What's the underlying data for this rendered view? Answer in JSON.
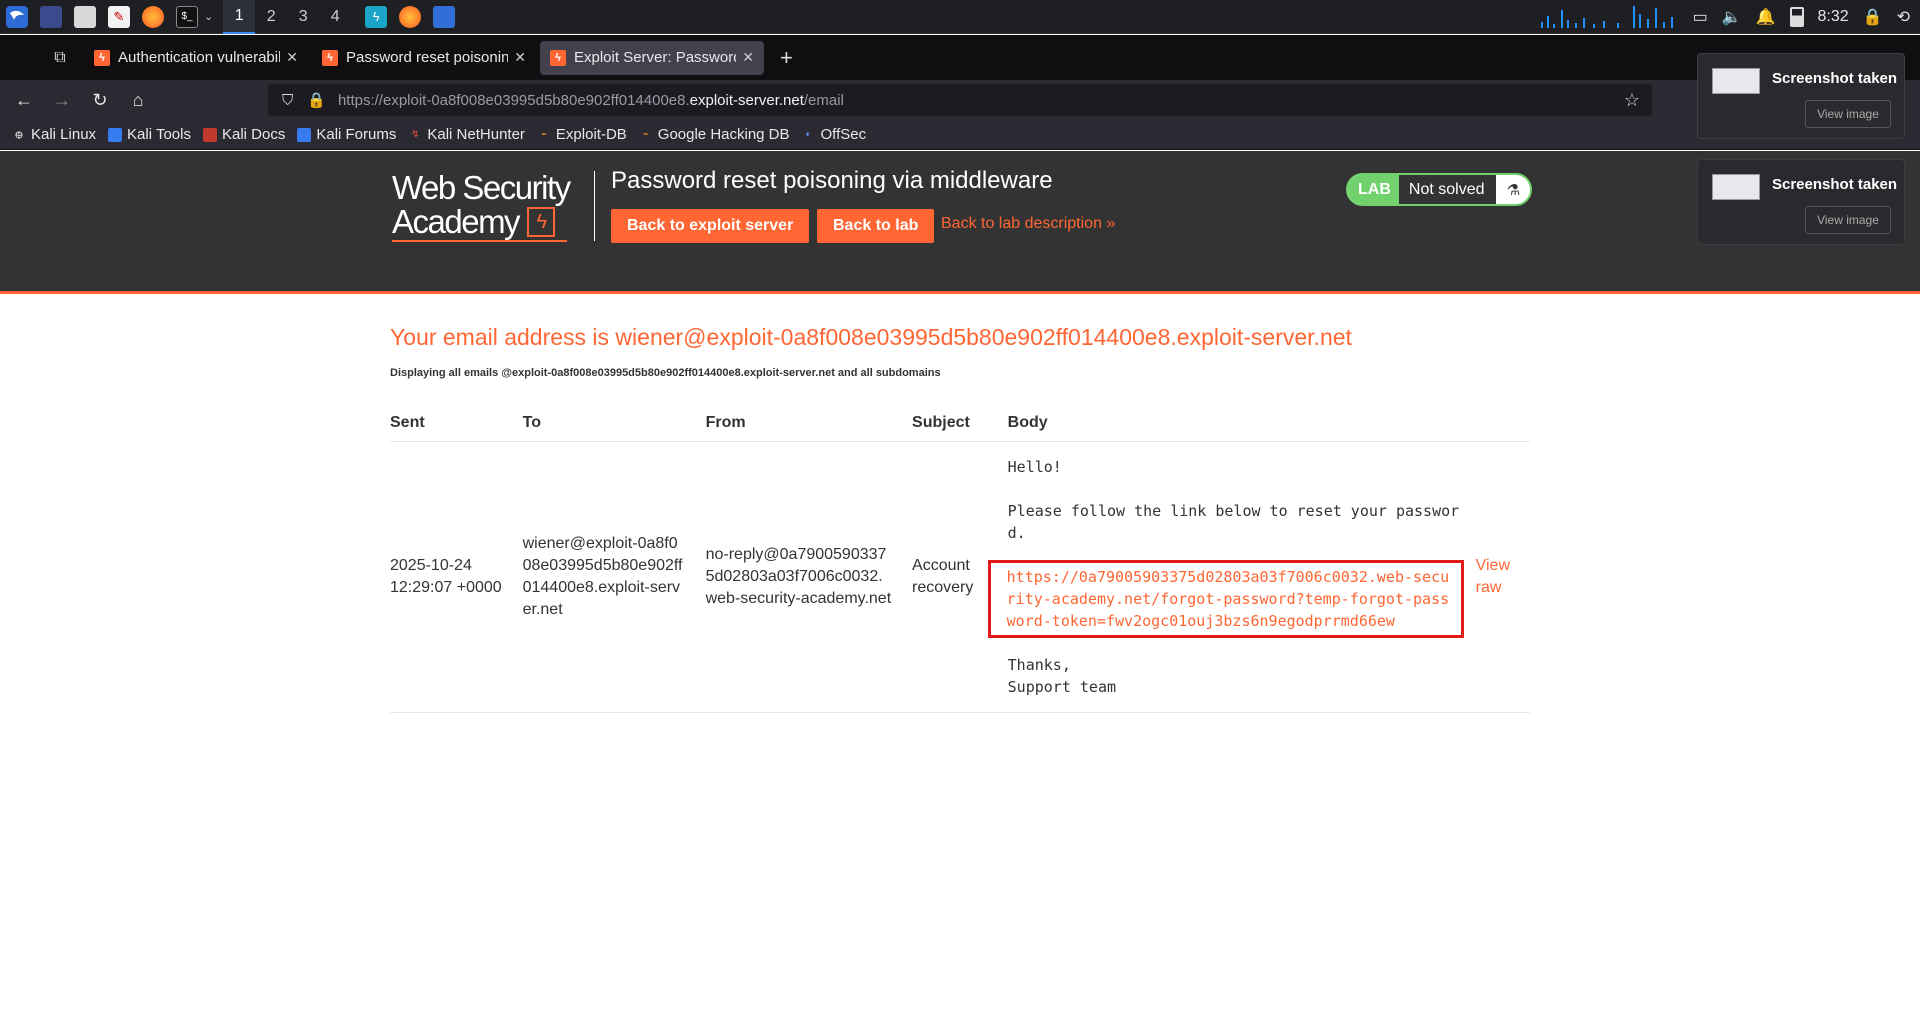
{
  "os": {
    "workspaces": [
      "1",
      "2",
      "3",
      "4"
    ],
    "clock": "8:32"
  },
  "browser": {
    "tabs": [
      {
        "title": "Authentication vulnerabilities"
      },
      {
        "title": "Password reset poisoning via middleware"
      },
      {
        "title": "Exploit Server: Password reset poisoning via middleware"
      }
    ],
    "url": {
      "prefix": "https://exploit-0a8f008e03995d5b80e902ff014400e8.",
      "host": "exploit-server.net",
      "path": "/email"
    },
    "bookmarks": [
      {
        "label": "Kali Linux",
        "icon": "kali-dragon-icon"
      },
      {
        "label": "Kali Tools",
        "icon": "kali-tools-icon"
      },
      {
        "label": "Kali Docs",
        "icon": "kali-docs-icon"
      },
      {
        "label": "Kali Forums",
        "icon": "kali-forums-icon"
      },
      {
        "label": "Kali NetHunter",
        "icon": "nethunter-icon"
      },
      {
        "label": "Exploit-DB",
        "icon": "exploit-db-icon"
      },
      {
        "label": "Google Hacking DB",
        "icon": "ghdb-icon"
      },
      {
        "label": "OffSec",
        "icon": "offsec-icon"
      }
    ]
  },
  "header": {
    "logo_line1": "Web Security",
    "logo_line2": "Academy",
    "lab_title": "Password reset poisoning via middleware",
    "back_to_exploit_server": "Back to exploit server",
    "back_to_lab": "Back to lab",
    "back_to_description": "Back to lab description",
    "status_tag": "LAB",
    "status_text": "Not solved"
  },
  "notifications": [
    {
      "title": "Screenshot taken",
      "button": "View image"
    },
    {
      "title": "Screenshot taken",
      "button": "View image"
    }
  ],
  "main": {
    "heading": "Your email address is wiener@exploit-0a8f008e03995d5b80e902ff014400e8.exploit-server.net",
    "note": "Displaying all emails @exploit-0a8f008e03995d5b80e902ff014400e8.exploit-server.net and all subdomains",
    "columns": [
      "Sent",
      "To",
      "From",
      "Subject",
      "Body"
    ],
    "email": {
      "sent": "2025-10-24 12:29:07 +0000",
      "to": "wiener@exploit-0a8f008e03995d5b80e902ff014400e8.exploit-server.net",
      "from": "no-reply@0a79005903375d02803a03f7006c0032.web-security-academy.net",
      "subject": "Account recovery",
      "body_intro": "Hello!\n\nPlease follow the link below to reset your password.",
      "body_link": "https://0a79005903375d02803a03f7006c0032.web-security-academy.net/forgot-password?temp-forgot-password-token=fwv2ogc01ouj3bzs6n9egodprrmd66ew",
      "body_outro": "Thanks,\nSupport team",
      "view_raw": "View raw"
    }
  },
  "colors": {
    "accent": "#ff6633",
    "header_bg": "#333333",
    "lab_green": "#70d16d",
    "highlight_box": "#e21a1a"
  }
}
